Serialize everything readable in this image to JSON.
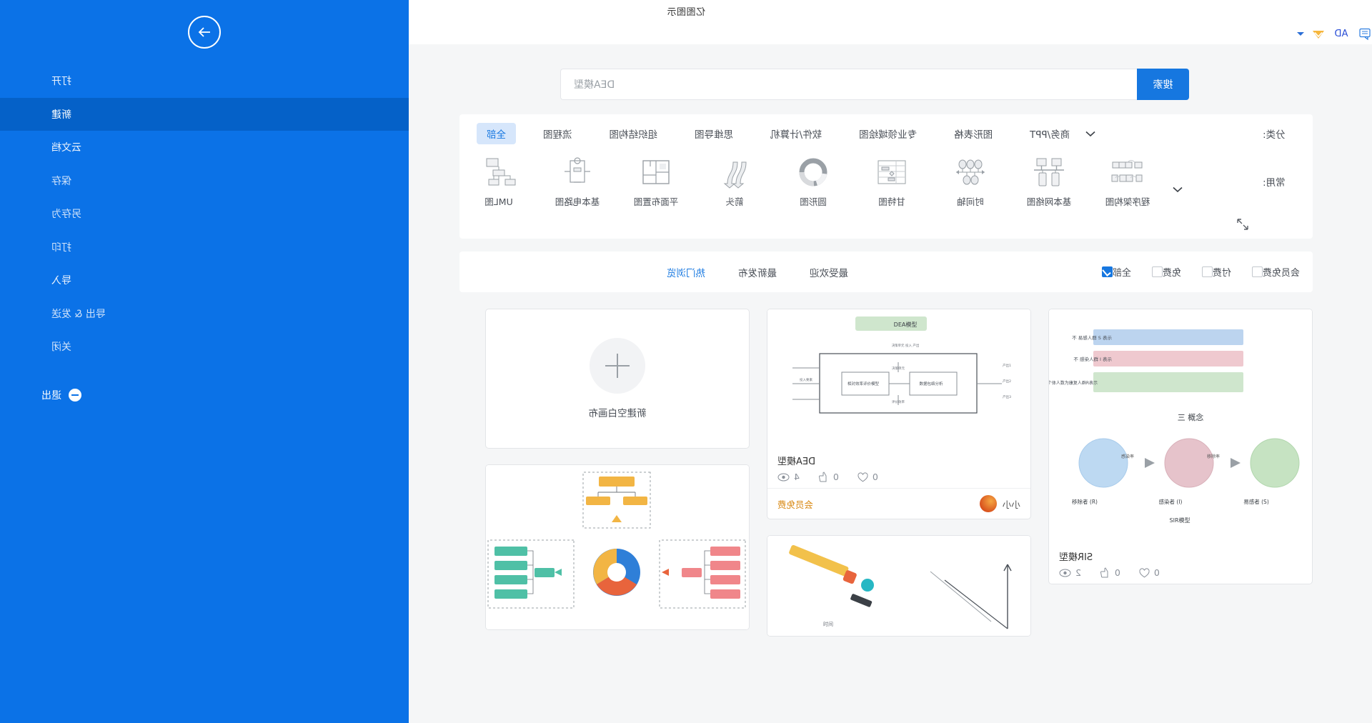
{
  "window": {
    "title": "亿图图示",
    "controls": {
      "minimize": "minimize-icon",
      "restore": "restore-icon",
      "close": "close-icon"
    },
    "quick_access": {
      "logo": "edraw-diamond-logo",
      "app_abbrev": "AD",
      "comment_icon": "comment-icon",
      "dropdown": "chevron-down-icon"
    }
  },
  "search": {
    "button_label": "搜索",
    "value": "DEA模型",
    "placeholder": "DEA模型"
  },
  "categories": {
    "label": "分类:",
    "items": [
      {
        "label": "全部",
        "active": true
      },
      {
        "label": "流程图",
        "active": false
      },
      {
        "label": "组织结构图",
        "active": false
      },
      {
        "label": "思维导图",
        "active": false
      },
      {
        "label": "软件/计算机",
        "active": false
      },
      {
        "label": "专业领域绘图",
        "active": false
      },
      {
        "label": "图形表格",
        "active": false
      },
      {
        "label": "商务/PPT",
        "active": false
      }
    ],
    "expand_icon": "chevron-down-icon"
  },
  "common": {
    "label": "常用:",
    "items": [
      {
        "name": "UML图",
        "icon": "uml-diagram-icon"
      },
      {
        "name": "基本电路图",
        "icon": "circuit-diagram-icon"
      },
      {
        "name": "平面布置图",
        "icon": "floor-plan-icon"
      },
      {
        "name": "箭头",
        "icon": "arrow-icon"
      },
      {
        "name": "圆形图",
        "icon": "donut-chart-icon"
      },
      {
        "name": "甘特图",
        "icon": "gantt-chart-icon"
      },
      {
        "name": "时间轴",
        "icon": "timeline-icon"
      },
      {
        "name": "基本网络图",
        "icon": "network-diagram-icon"
      },
      {
        "name": "程序架构图",
        "icon": "program-architecture-icon"
      }
    ],
    "expand_icon": "chevron-down-icon",
    "fullscreen_icon": "expand-arrows-icon"
  },
  "sorts": [
    {
      "label": "热门浏览",
      "active": true
    },
    {
      "label": "最新发布",
      "active": false
    },
    {
      "label": "最受欢迎",
      "active": false
    }
  ],
  "filters": [
    {
      "label": "全部",
      "checked": true
    },
    {
      "label": "免费",
      "checked": false
    },
    {
      "label": "付费",
      "checked": false
    },
    {
      "label": "会员免费",
      "checked": false
    }
  ],
  "templates": {
    "column_a": [
      {
        "title": "SIR模型",
        "views": "2",
        "likes": "0",
        "favorites": "0",
        "thumb_type": "sir-model",
        "thumb": {
          "heading": "三 概念",
          "bars": [
            {
              "text": "不 易感人群 S 表示",
              "color": "#bcd4ef"
            },
            {
              "text": "不 感染人群 I 表示",
              "color": "#efc9cf"
            },
            {
              "text": "移除人群包括免疫者和死亡者在内的个体人数为康复人群R表示",
              "color": "#cfe6cd"
            }
          ],
          "caption": "SIR模型",
          "nodes": [
            {
              "label": "易感者 (S)",
              "color": "#bcd9f2"
            },
            {
              "label": "感染者 (I)",
              "color": "#e9c3cb"
            },
            {
              "label": "移除者 (R)",
              "color": "#c3e0bf"
            }
          ],
          "edges": [
            "感染率",
            "移除率"
          ]
        }
      }
    ],
    "column_b": [
      {
        "title": "DEA模型",
        "views": "4",
        "likes": "0",
        "favorites": "0",
        "price_label": "会员免费",
        "author": "小小",
        "thumb_type": "dea-model",
        "thumb": {
          "badge": "DEA模型",
          "note": "决策单元 投入 产出",
          "boxes": [
            "相对效率评价模型",
            "数据包络分析"
          ],
          "outputs": [
            "产出1",
            "产出2",
            "产出3"
          ]
        }
      },
      {
        "title": "",
        "thumb_type": "sketch-tools"
      }
    ],
    "column_c": [
      {
        "blank_label": "新建空白画布",
        "thumb_type": "blank",
        "icon": "plus-icon"
      },
      {
        "title": "",
        "thumb_type": "org-mindmap"
      }
    ]
  },
  "sidebar": {
    "back_icon": "arrow-right-circle-icon",
    "items": [
      {
        "label": "打开",
        "active": false,
        "dim": false
      },
      {
        "label": "新建",
        "active": true,
        "dim": false
      },
      {
        "label": "云文档",
        "active": false,
        "dim": false
      },
      {
        "label": "保存",
        "active": false,
        "dim": true
      },
      {
        "label": "另存为",
        "active": false,
        "dim": true
      },
      {
        "label": "打印",
        "active": false,
        "dim": true
      },
      {
        "label": "导入",
        "active": false,
        "dim": false
      },
      {
        "label": "导出 & 发送",
        "active": false,
        "dim": true
      },
      {
        "label": "关闭",
        "active": false,
        "dim": true
      }
    ],
    "exit": {
      "label": "退出",
      "icon": "minus-circle-icon"
    },
    "accent": "#0b72e7",
    "accent_active": "#0561c8"
  }
}
